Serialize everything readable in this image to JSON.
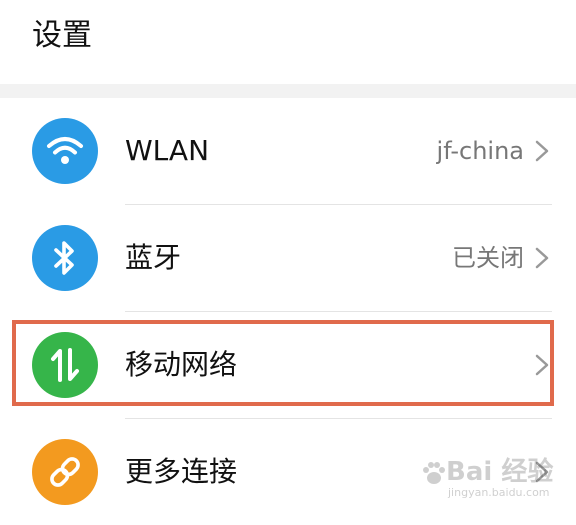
{
  "header": {
    "title": "设置"
  },
  "settings": [
    {
      "label": "WLAN",
      "value": "jf-china",
      "icon": "wifi-icon",
      "icon_color": "#2a9be5"
    },
    {
      "label": "蓝牙",
      "value": "已关闭",
      "icon": "bluetooth-icon",
      "icon_color": "#2a9be5"
    },
    {
      "label": "移动网络",
      "value": "",
      "icon": "data-transfer-icon",
      "icon_color": "#36b54a"
    },
    {
      "label": "更多连接",
      "value": "",
      "icon": "link-icon",
      "icon_color": "#f39a1f"
    }
  ],
  "highlight": {
    "color": "#e06a4c",
    "target": "移动网络"
  },
  "watermark": {
    "main": "Bai 经验",
    "sub": "jingyan.baidu.com"
  }
}
